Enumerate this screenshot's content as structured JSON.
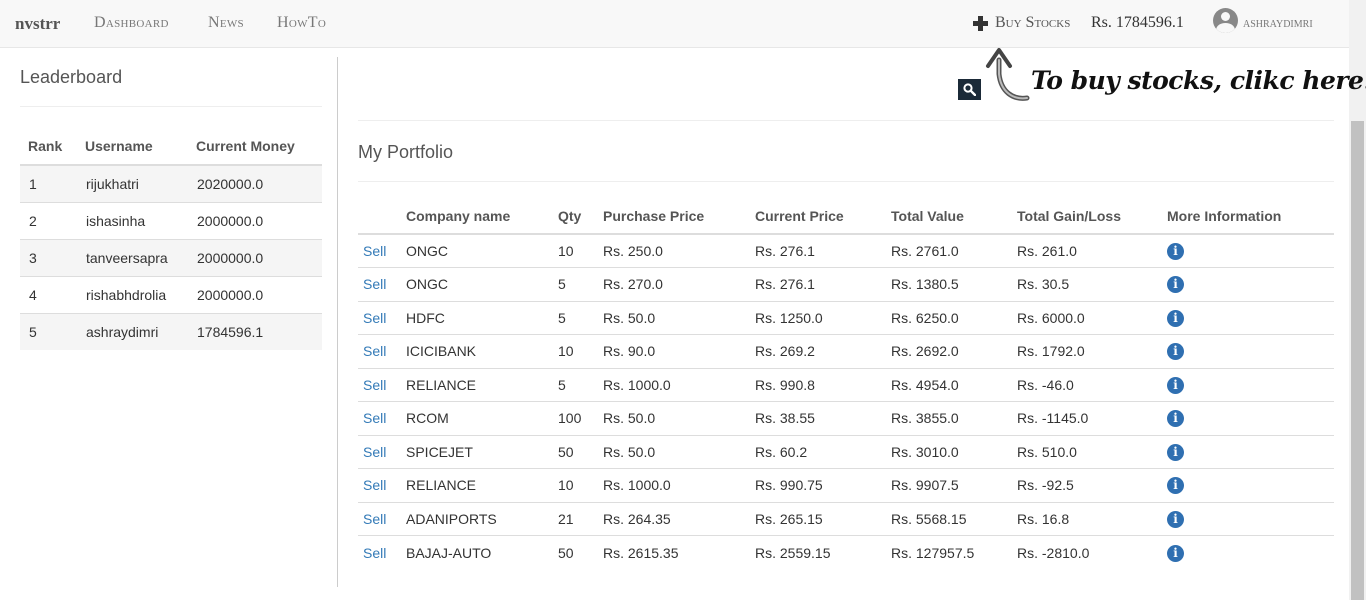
{
  "navbar": {
    "brand": "nvstrr",
    "links": [
      "Dashboard",
      "News",
      "HowTo"
    ],
    "buy_stocks": "Buy Stocks",
    "balance": "Rs. 1784596.1",
    "username": "ashraydimri"
  },
  "leaderboard": {
    "title": "Leaderboard",
    "headers": [
      "Rank",
      "Username",
      "Current Money"
    ],
    "rows": [
      [
        "1",
        "rijukhatri",
        "2020000.0"
      ],
      [
        "2",
        "ishasinha",
        "2000000.0"
      ],
      [
        "3",
        "tanveersapra",
        "2000000.0"
      ],
      [
        "4",
        "rishabhdrolia",
        "2000000.0"
      ],
      [
        "5",
        "ashraydimri",
        "1784596.1"
      ]
    ]
  },
  "annotation": "To buy stocks, clikc here.",
  "portfolio": {
    "title": "My Portfolio",
    "headers": [
      "",
      "Company name",
      "Qty",
      "Purchase Price",
      "Current Price",
      "Total Value",
      "Total Gain/Loss",
      "More Information"
    ],
    "sell_label": "Sell",
    "rows": [
      {
        "company": "ONGC",
        "qty": "10",
        "purchase": "Rs. 250.0",
        "current": "Rs. 276.1",
        "total": "Rs. 2761.0",
        "gain": "Rs. 261.0",
        "status": "gain"
      },
      {
        "company": "ONGC",
        "qty": "5",
        "purchase": "Rs. 270.0",
        "current": "Rs. 276.1",
        "total": "Rs. 1380.5",
        "gain": "Rs. 30.5",
        "status": "gain"
      },
      {
        "company": "HDFC",
        "qty": "5",
        "purchase": "Rs. 50.0",
        "current": "Rs. 1250.0",
        "total": "Rs. 6250.0",
        "gain": "Rs. 6000.0",
        "status": "gain"
      },
      {
        "company": "ICICIBANK",
        "qty": "10",
        "purchase": "Rs. 90.0",
        "current": "Rs. 269.2",
        "total": "Rs. 2692.0",
        "gain": "Rs. 1792.0",
        "status": "gain"
      },
      {
        "company": "RELIANCE",
        "qty": "5",
        "purchase": "Rs. 1000.0",
        "current": "Rs. 990.8",
        "total": "Rs. 4954.0",
        "gain": "Rs. -46.0",
        "status": "loss"
      },
      {
        "company": "RCOM",
        "qty": "100",
        "purchase": "Rs. 50.0",
        "current": "Rs. 38.55",
        "total": "Rs. 3855.0",
        "gain": "Rs. -1145.0",
        "status": "loss"
      },
      {
        "company": "SPICEJET",
        "qty": "50",
        "purchase": "Rs. 50.0",
        "current": "Rs. 60.2",
        "total": "Rs. 3010.0",
        "gain": "Rs. 510.0",
        "status": "gain"
      },
      {
        "company": "RELIANCE",
        "qty": "10",
        "purchase": "Rs. 1000.0",
        "current": "Rs. 990.75",
        "total": "Rs. 9907.5",
        "gain": "Rs. -92.5",
        "status": "loss"
      },
      {
        "company": "ADANIPORTS",
        "qty": "21",
        "purchase": "Rs. 264.35",
        "current": "Rs. 265.15",
        "total": "Rs. 5568.15",
        "gain": "Rs. 16.8",
        "status": "gain"
      },
      {
        "company": "BAJAJ-AUTO",
        "qty": "50",
        "purchase": "Rs. 2615.35",
        "current": "Rs. 2559.15",
        "total": "Rs. 127957.5",
        "gain": "Rs. -2810.0",
        "status": "loss"
      }
    ]
  },
  "icons": {
    "plus": "plus-icon",
    "user": "user-icon",
    "search": "search-icon",
    "info": "info-icon",
    "arrow": "curved-arrow-icon"
  },
  "colors": {
    "gain": "#1a8a1a",
    "loss": "#d0231c",
    "link": "#337ab7",
    "info": "#2f6fb1"
  }
}
